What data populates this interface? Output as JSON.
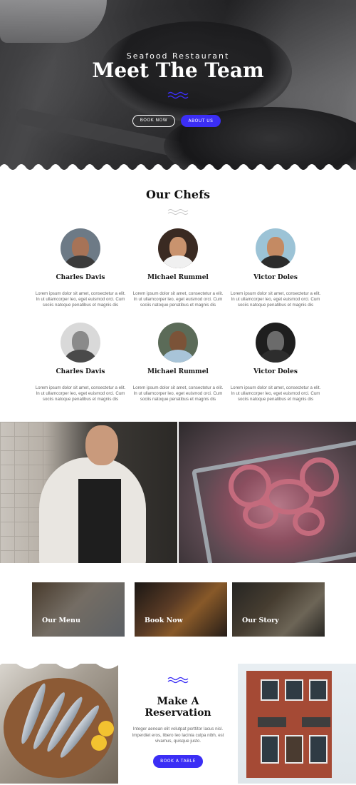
{
  "hero": {
    "eyebrow": "Seafood Restaurant",
    "title": "Meet The Team",
    "book_now_label": "BOOK NOW",
    "about_us_label": "ABOUT US"
  },
  "chefs_section": {
    "title": "Our Chefs",
    "chefs": [
      {
        "name": "Charles Davis",
        "bio": "Lorem ipsum dolor sit amet, consectetur a elit. In ut ullamcorper leo, eget euismod orci. Cum sociis natoque penatibus et magnis dis"
      },
      {
        "name": "Michael Rummel",
        "bio": "Lorem ipsum dolor sit amet, consectetur a elit. In ut ullamcorper leo, eget euismod orci. Cum sociis natoque penatibus et magnis dis"
      },
      {
        "name": "Victor Doles",
        "bio": "Lorem ipsum dolor sit amet, consectetur a elit. In ut ullamcorper leo, eget euismod orci. Cum sociis natoque penatibus et magnis dis"
      },
      {
        "name": "Charles Davis",
        "bio": "Lorem ipsum dolor sit amet, consectetur a elit. In ut ullamcorper leo, eget euismod orci. Cum sociis natoque penatibus et magnis dis"
      },
      {
        "name": "Michael Rummel",
        "bio": "Lorem ipsum dolor sit amet, consectetur a elit. In ut ullamcorper leo, eget euismod orci. Cum sociis natoque penatibus et magnis dis"
      },
      {
        "name": "Victor Doles",
        "bio": "Lorem ipsum dolor sit amet, consectetur a elit. In ut ullamcorper leo, eget euismod orci. Cum sociis natoque penatibus et magnis dis"
      }
    ]
  },
  "cards": [
    {
      "label": "Our Menu"
    },
    {
      "label": "Book Now"
    },
    {
      "label": "Our Story"
    }
  ],
  "reservation": {
    "title_line1": "Make A",
    "title_line2": "Reservation",
    "text": "Integer aenean elit volutpat porttitor lacus nisl. Imperdiet eros, libero leo lacinia culpa nibh, est vivamus, quisque justo.",
    "button_label": "BOOK A TABLE"
  },
  "colors": {
    "accent": "#3b2ef5",
    "heading": "#111111",
    "body_text": "#666666"
  },
  "icons": {
    "hero_divider": "wave-icon",
    "section_divider": "wave-icon"
  }
}
